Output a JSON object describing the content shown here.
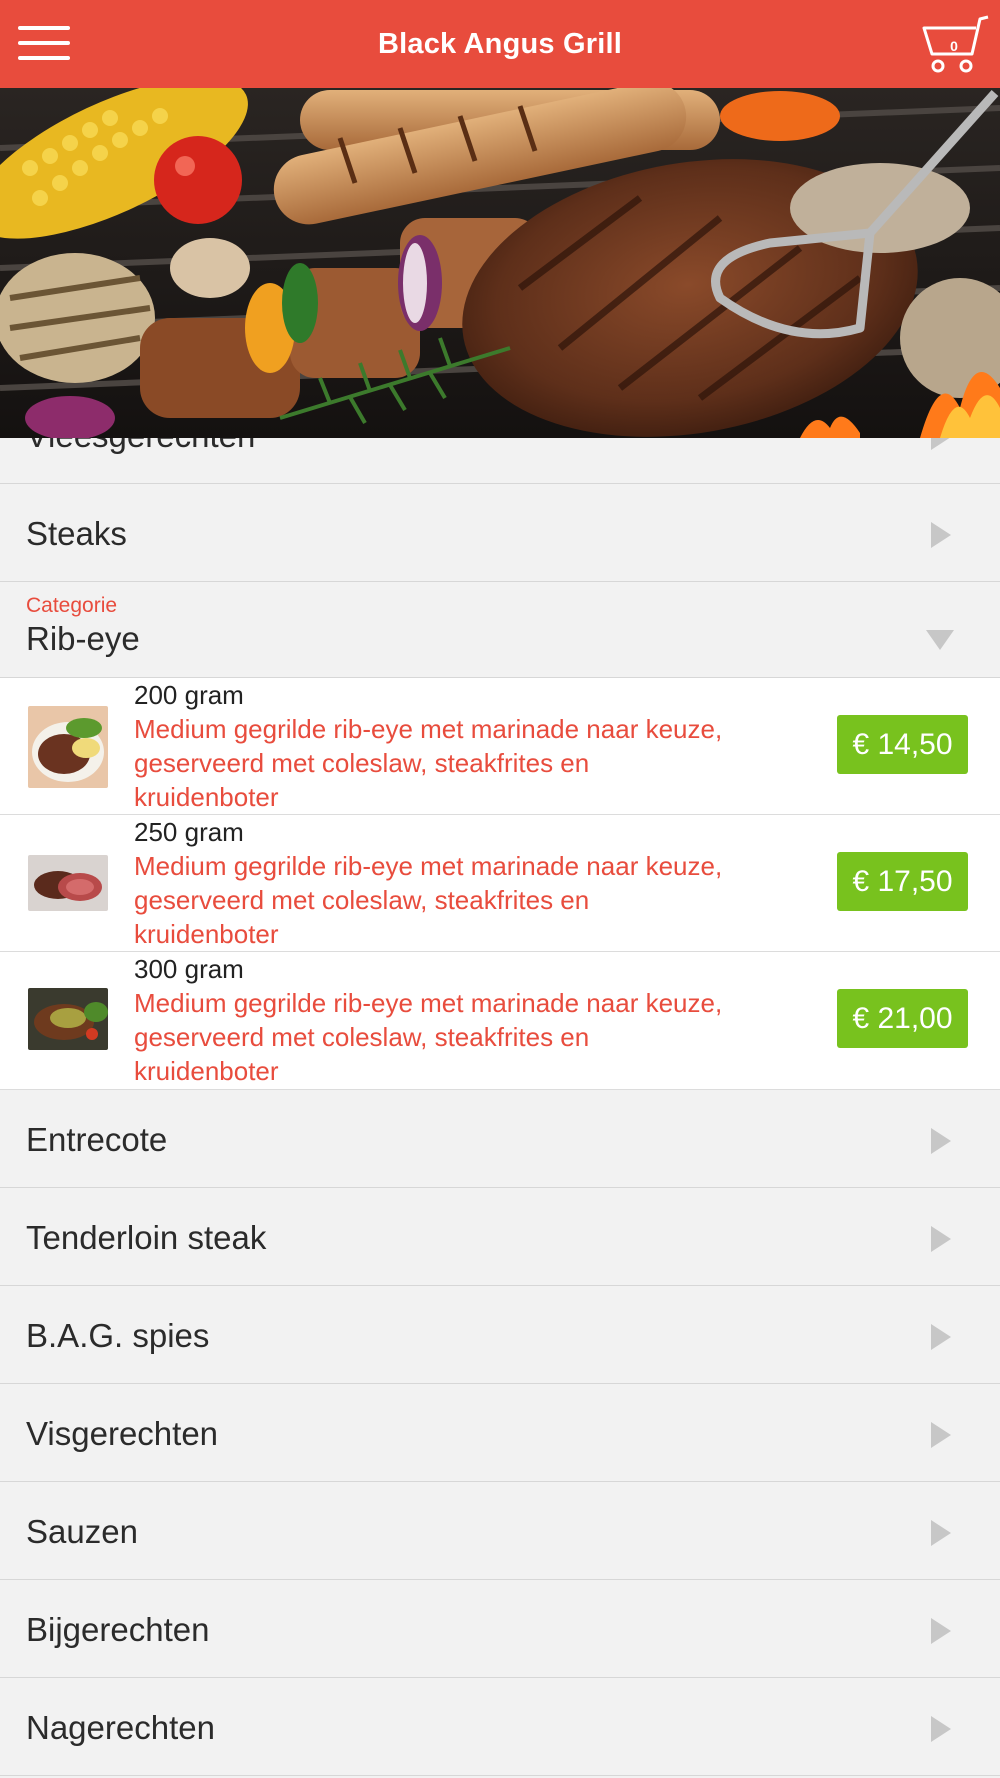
{
  "header": {
    "title": "Black Angus Grill",
    "cart_count": "0"
  },
  "categories_top": [
    {
      "label": "Vleesgerechten"
    },
    {
      "label": "Steaks"
    }
  ],
  "open_category": {
    "small_label": "Categorie",
    "label": "Rib-eye"
  },
  "products": [
    {
      "name": "200 gram",
      "description": "Medium gegrilde rib-eye met marinade naar keuze, geserveerd met coleslaw, steakfrites en kruidenboter",
      "price": "€ 14,50"
    },
    {
      "name": "250 gram",
      "description": "Medium gegrilde rib-eye met marinade naar keuze, geserveerd met coleslaw, steakfrites en kruidenboter",
      "price": "€ 17,50"
    },
    {
      "name": "300 gram",
      "description": "Medium gegrilde rib-eye met marinade naar keuze, geserveerd met coleslaw, steakfrites en kruidenboter",
      "price": "€ 21,00"
    }
  ],
  "categories_bottom": [
    {
      "label": "Entrecote"
    },
    {
      "label": "Tenderloin steak"
    },
    {
      "label": "B.A.G. spies"
    },
    {
      "label": "Visgerechten"
    },
    {
      "label": "Sauzen"
    },
    {
      "label": "Bijgerechten"
    },
    {
      "label": "Nagerechten"
    }
  ],
  "colors": {
    "brand_red": "#e84c3d",
    "price_green": "#78c21e",
    "row_bg": "#f2f2f2"
  }
}
